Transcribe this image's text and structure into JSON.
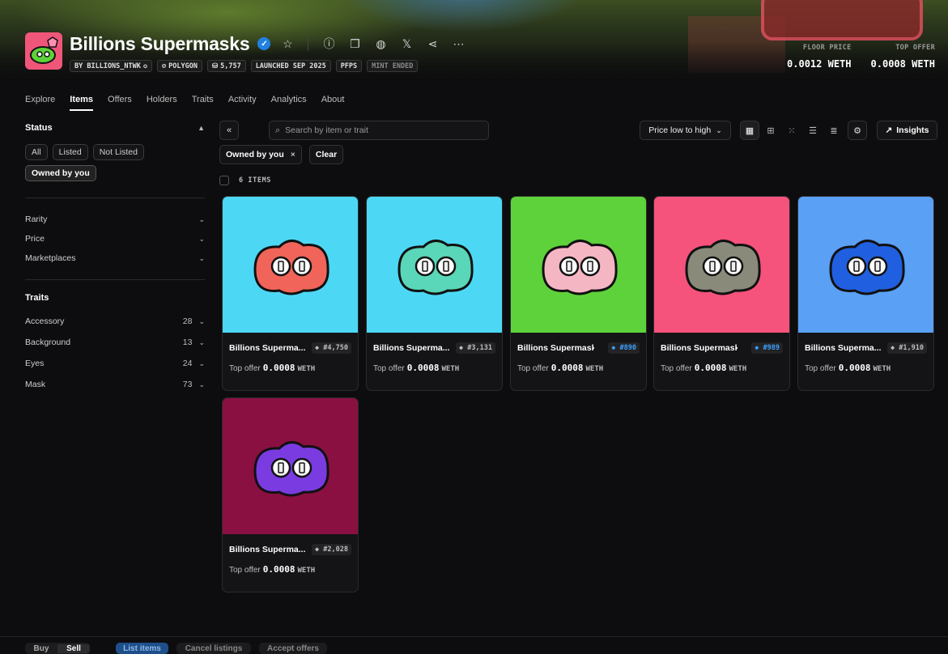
{
  "collection": {
    "name": "Billions Supermasks",
    "chips": [
      "BY BILLIONS_NTWK",
      "POLYGON",
      "5,757",
      "LAUNCHED SEP 2025",
      "PFPS",
      "MINT ENDED"
    ],
    "floor_label": "FLOOR PRICE",
    "floor_value": "0.0012 WETH",
    "offer_label": "TOP OFFER",
    "offer_value": "0.0008 WETH"
  },
  "tabs": [
    "Explore",
    "Items",
    "Offers",
    "Holders",
    "Traits",
    "Activity",
    "Analytics",
    "About"
  ],
  "sidebar": {
    "status_title": "Status",
    "status_pills": [
      "All",
      "Listed",
      "Not Listed",
      "Owned by you"
    ],
    "filters": [
      "Rarity",
      "Price",
      "Marketplaces"
    ],
    "traits_title": "Traits",
    "traits": [
      {
        "name": "Accessory",
        "count": "28"
      },
      {
        "name": "Background",
        "count": "13"
      },
      {
        "name": "Eyes",
        "count": "24"
      },
      {
        "name": "Mask",
        "count": "73"
      }
    ]
  },
  "toolbar": {
    "search_placeholder": "Search by item or trait",
    "sort_label": "Price low to high",
    "insights_label": "Insights"
  },
  "active_filters": {
    "chip": "Owned by you",
    "clear": "Clear"
  },
  "items_count": "6 ITEMS",
  "items": [
    {
      "name": "Billions Superma...",
      "rank": "#4,750",
      "rank_color": "gray",
      "offer_label": "Top offer",
      "offer_price": "0.0008",
      "offer_unit": "WETH",
      "bg": "#4cd8f5",
      "body": "#f0645a"
    },
    {
      "name": "Billions Superma...",
      "rank": "#3,131",
      "rank_color": "gray",
      "offer_label": "Top offer",
      "offer_price": "0.0008",
      "offer_unit": "WETH",
      "bg": "#4cd8f5",
      "body": "#5ad6b8"
    },
    {
      "name": "Billions Supermask...",
      "rank": "#890",
      "rank_color": "blue",
      "offer_label": "Top offer",
      "offer_price": "0.0008",
      "offer_unit": "WETH",
      "bg": "#5ed23a",
      "body": "#f5b6c4"
    },
    {
      "name": "Billions Supermask...",
      "rank": "#989",
      "rank_color": "blue",
      "offer_label": "Top offer",
      "offer_price": "0.0008",
      "offer_unit": "WETH",
      "bg": "#f5527c",
      "body": "#8a8a7a"
    },
    {
      "name": "Billions Superma...",
      "rank": "#1,910",
      "rank_color": "gray",
      "offer_label": "Top offer",
      "offer_price": "0.0008",
      "offer_unit": "WETH",
      "bg": "#5aa0f5",
      "body": "#2060e0"
    },
    {
      "name": "Billions Superma...",
      "rank": "#2,028",
      "rank_color": "gray",
      "offer_label": "Top offer",
      "offer_price": "0.0008",
      "offer_unit": "WETH",
      "bg": "#8a1042",
      "body": "#7a3ce0"
    }
  ],
  "bottom_bar": {
    "buy": "Buy",
    "sell": "Sell",
    "list": "List items",
    "cancel": "Cancel listings",
    "accept": "Accept offers"
  },
  "colors": {
    "accent_blue": "#2081e2",
    "background": "#0d0d0f"
  }
}
